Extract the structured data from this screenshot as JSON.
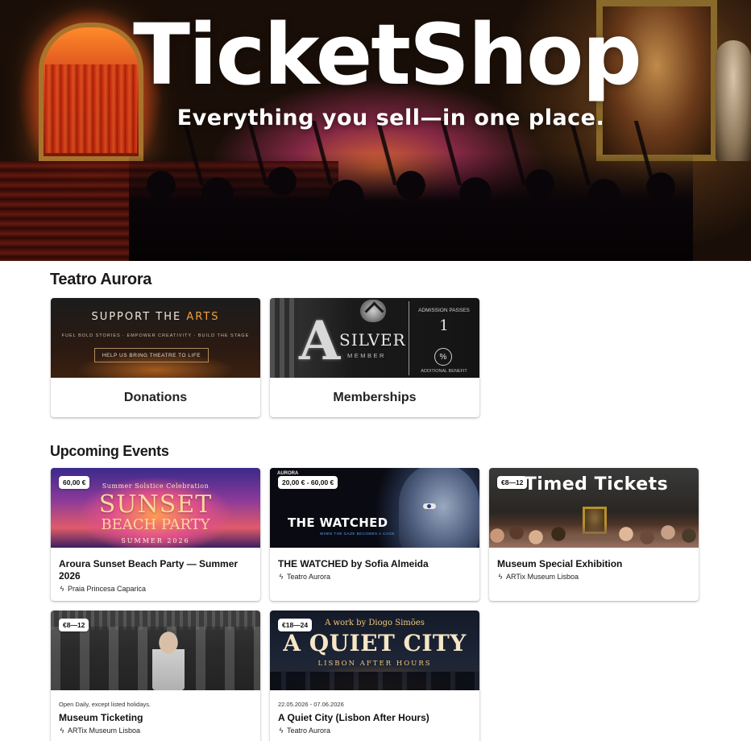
{
  "hero": {
    "title": "TicketShop",
    "subtitle": "Everything you sell—in one place."
  },
  "venue_section": {
    "title": "Teatro Aurora",
    "cards": [
      {
        "label": "Donations",
        "thumb": {
          "line1a": "SUPPORT THE ",
          "line1b": "ARTS",
          "line2": "FUEL BOLD STORIES · EMPOWER CREATIVITY · BUILD THE STAGE",
          "button": "HELP US BRING THEATRE TO LIFE"
        }
      },
      {
        "label": "Memberships",
        "thumb": {
          "big_letter": "A",
          "title": "SILVER",
          "subtitle": "MEMBER",
          "passes_label": "ADMISSION PASSES",
          "passes_value": "1",
          "percent_symbol": "%",
          "benefit_label": "ADDITIONAL BENEFIT"
        }
      }
    ]
  },
  "events_section": {
    "title": "Upcoming Events",
    "events": [
      {
        "price": "60,00 €",
        "title": "Aroura Sunset Beach Party — Summer 2026",
        "venue": "Praia Princesa Caparica",
        "meta": "",
        "thumb": {
          "line1": "Summer Solstice Celebration",
          "line2": "SUNSET",
          "line3": "BEACH PARTY",
          "line4": "SUMMER 2026"
        }
      },
      {
        "price": "20,00 € - 60,00 €",
        "title": "THE WATCHED by Sofia Almeida",
        "venue": "Teatro Aurora",
        "meta": "",
        "thumb": {
          "corner": "AURORA",
          "line1": "THE WATCHED",
          "line2": "WHEN THE GAZE BECOMES A CAGE."
        }
      },
      {
        "price": "€8—12",
        "title": "Museum Special Exhibition",
        "venue": "ARTix Museum Lisboa",
        "meta": "",
        "thumb": {
          "line1": "Timed Tickets"
        }
      },
      {
        "price": "€8—12",
        "title": "Museum Ticketing",
        "venue": "ARTix Museum Lisboa",
        "meta": "Open Daily, except listed holidays.",
        "thumb": {}
      },
      {
        "price": "€18—24",
        "title": "A Quiet City (Lisbon After Hours)",
        "venue": "Teatro Aurora",
        "meta": "22.05.2026 - 07.06.2026",
        "thumb": {
          "line1": "A work by Diogo Simões",
          "line2": "A QUIET CITY",
          "line3": "LISBON AFTER HOURS"
        }
      }
    ]
  },
  "icons": {
    "venue_pin": "location-pin-icon"
  }
}
